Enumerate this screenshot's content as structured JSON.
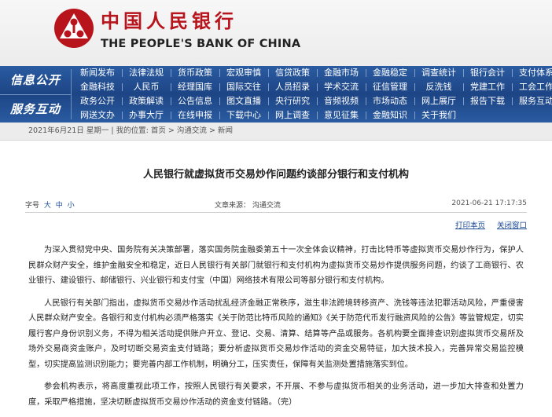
{
  "header": {
    "logo_cn": "中国人民银行",
    "logo_en": "THE PEOPLE'S BANK OF CHINA",
    "emblem_icon": "pboc-emblem-icon",
    "brand_color": "#b8141c"
  },
  "nav": {
    "section1_label": "信息公开",
    "section2_label": "服务互动",
    "rows": [
      [
        "新闻发布",
        "法律法规",
        "货币政策",
        "宏观审慎",
        "信贷政策",
        "金融市场",
        "金融稳定",
        "调查统计",
        "银行会计",
        "支付体系"
      ],
      [
        "金融科技",
        "人民币",
        "经理国库",
        "国际交往",
        "人员招录",
        "学术交流",
        "征信管理",
        "反洗钱",
        "党建工作",
        "工会工作"
      ],
      [
        "政务公开",
        "政策解读",
        "公告信息",
        "图文直播",
        "央行研究",
        "音频视频",
        "市场动态",
        "网上展厅",
        "报告下载",
        "服务互动"
      ],
      [
        "网送文办",
        "办事大厅",
        "在线申报",
        "下载中心",
        "网上调查",
        "意见征集",
        "金融知识",
        "关于我们"
      ]
    ]
  },
  "breadcrumb": {
    "date": "2021年6月21日 星期一",
    "prefix": "我的位置:",
    "home": "首页",
    "level1": "沟通交流",
    "level2": "新闻",
    "sep": ">"
  },
  "article": {
    "title": "人民银行就虚拟货币交易炒作问题约谈部分银行和支付机构",
    "fontsize_label": "字号",
    "fontsize_large": "大",
    "fontsize_medium": "中",
    "fontsize_small": "小",
    "source": "文章来源：  沟通交流",
    "datetime": "2021-06-21  17:17:35",
    "print_label": "打印本页",
    "close_label": "关闭窗口",
    "paragraphs": [
      "为深入贯彻党中央、国务院有关决策部署，落实国务院金融委第五十一次全体会议精神，打击比特币等虚拟货币交易炒作行为，保护人民群众财产安全，维护金融安全和稳定，近日人民银行有关部门就银行和支付机构为虚拟货币交易炒作提供服务问题，约谈了工商银行、农业银行、建设银行、邮储银行、兴业银行和支付宝（中国）网络技术有限公司等部分银行和支付机构。",
      "人民银行有关部门指出，虚拟货币交易炒作活动扰乱经济金融正常秩序，滋生非法跨境转移资产、洗钱等违法犯罪活动风险，严重侵害人民群众财产安全。各银行和支付机构必须严格落实《关于防范比特币风险的通知》《关于防范代币发行融资风险的公告》等监管规定，切实履行客户身份识别义务，不得为相关活动提供账户开立、登记、交易、清算、结算等产品或服务。各机构要全面排查识别虚拟货币交易所及场外交易商资金账户，及时切断交易资金支付链路；要分析虚拟货币交易炒作活动的资金交易特征，加大技术投入，完善异常交易监控模型，切实提高监测识别能力；要完善内部工作机制，明确分工，压实责任，保障有关监测处置措施落实到位。",
      "参会机构表示，将高度重视此项工作，按照人民银行有关要求，不开展、不参与虚拟货币相关的业务活动，进一步加大排查和处置力度，采取严格措施，坚决切断虚拟货币交易炒作活动的资金支付链路。（完）"
    ]
  }
}
